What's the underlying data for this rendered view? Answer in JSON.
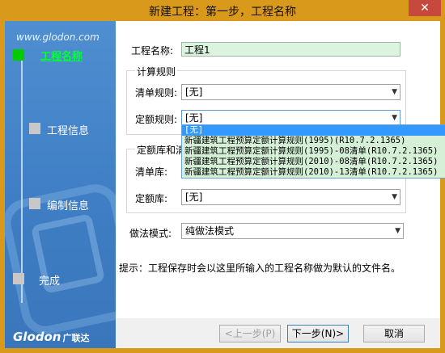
{
  "window": {
    "title": "新建工程：第一步，工程名称",
    "close_glyph": "✕"
  },
  "left_panel": {
    "url_text": "www.glodon.com",
    "steps": [
      {
        "label": "工程名称",
        "active": true
      },
      {
        "label": "工程信息",
        "active": false
      },
      {
        "label": "编制信息",
        "active": false
      },
      {
        "label": "完成",
        "active": false
      }
    ],
    "logo_text": "Glodon",
    "logo_cn": "广联达"
  },
  "form": {
    "project_name_label": "工程名称:",
    "project_name_value": "工程1",
    "calc_rules_group_title": "计算规则",
    "bill_rule_label": "清单规则:",
    "bill_rule_value": "[无]",
    "quota_rule_label": "定额规则:",
    "quota_rule_value": "[无]",
    "library_group_title": "定额库和清",
    "bill_lib_label": "清单库:",
    "quota_lib_label": "定额库:",
    "quota_lib_value": "[无]",
    "method_label": "做法模式:",
    "method_value": "纯做法模式"
  },
  "dropdown": {
    "items": [
      "[无]",
      "新疆建筑工程预算定额计算规则(1995)(R10.7.2.1365)",
      "新疆建筑工程预算定额计算规则(1995)-08清单(R10.7.2.1365)",
      "新疆建筑工程预算定额计算规则(2010)-08清单(R10.7.2.1365)",
      "新疆建筑工程预算定额计算规则(2010)-13清单(R10.7.2.1365)"
    ]
  },
  "hint_text": "提示：工程保存时会以这里所输入的工程名称做为默认的文件名。",
  "buttons": {
    "prev": "<上一步(P)",
    "next": "下一步(N)>",
    "cancel": "取消"
  },
  "icons": {
    "dropdown_arrow": "chevron-down-icon"
  },
  "colors": {
    "title_bar": "#d99a1c",
    "left_panel": "#4f8fd0",
    "active_step": "#00cc00",
    "name_field_bg": "#dcf3df",
    "selected_item": "#3399ff"
  }
}
